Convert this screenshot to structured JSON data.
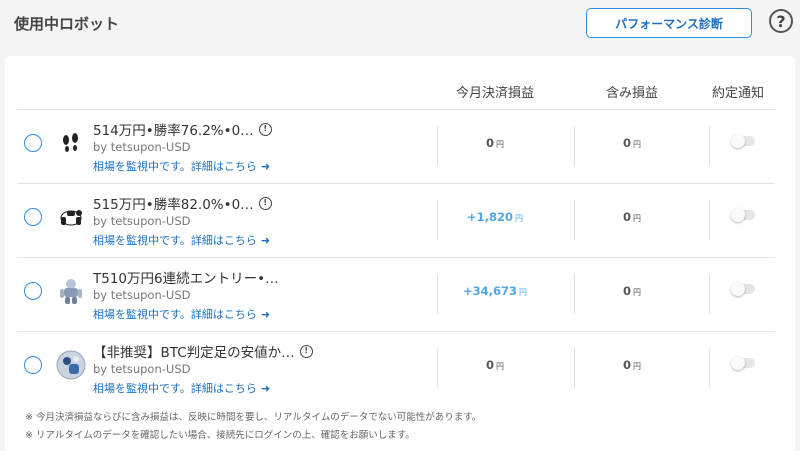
{
  "page": {
    "title": "使用中ロボット",
    "performance_button": "パフォーマンス診断",
    "help_label": "?"
  },
  "colors": {
    "accent": "#2f8ee0",
    "link": "#1d6fc0",
    "positive_amount": "#4ea8e8"
  },
  "table": {
    "headers": {
      "monthly_pl": "今月決済損益",
      "unrealized_pl": "含み損益",
      "notify": "約定通知"
    },
    "currency_unit": "円",
    "rows": [
      {
        "name": "514万円•勝率76.2%•0…",
        "author": "by tetsupon-USD",
        "status": "相場を監視中です。詳細はこちら",
        "monthly_pl": "0",
        "unrealized_pl": "0",
        "avatar_icon": "footprints-icon",
        "notify_on": false
      },
      {
        "name": "515万円•勝率82.0%•0…",
        "author": "by tetsupon-USD",
        "status": "相場を監視中です。詳細はこちら",
        "monthly_pl": "+1,820",
        "unrealized_pl": "0",
        "avatar_icon": "panda-icon",
        "notify_on": false
      },
      {
        "name": "T510万円6連続エントリー•…",
        "author": "by tetsupon-USD",
        "status": "相場を監視中です。詳細はこちら",
        "monthly_pl": "+34,673",
        "unrealized_pl": "0",
        "avatar_icon": "robot-figure-icon",
        "notify_on": false
      },
      {
        "name": "【非推奨】BTC判定足の安値か…",
        "author": "by tetsupon-USD",
        "status": "相場を監視中です。詳細はこちら",
        "monthly_pl": "0",
        "unrealized_pl": "0",
        "avatar_icon": "photo-avatar-icon",
        "notify_on": false
      }
    ]
  },
  "footnotes": [
    "※ 今月決済損益ならびに含み損益は、反映に時間を要し、リアルタイムのデータでない可能性があります。",
    "※ リアルタイムのデータを確認したい場合、接続先にログインの上、確認をお願いします。"
  ]
}
